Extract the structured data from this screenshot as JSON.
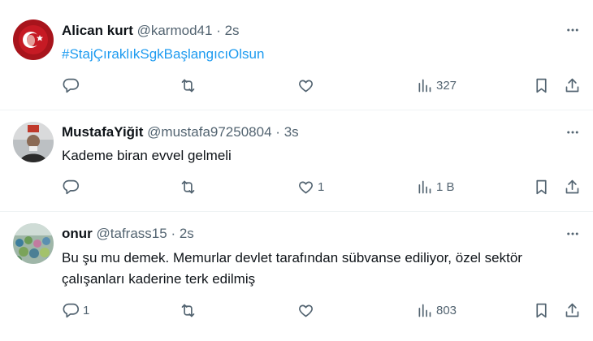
{
  "tweets": [
    {
      "name": "Alican kurt",
      "handle": "@karmod41",
      "separator": "·",
      "time": "2s",
      "text": "#StajÇıraklıkSgkBaşlangıcıOlsun",
      "text_is_hashtag": true,
      "replies": "",
      "retweets": "",
      "likes": "",
      "views": "327",
      "avatar": "turkish-flag-avatar"
    },
    {
      "name": "MustafaYiğit",
      "handle": "@mustafa97250804",
      "separator": "·",
      "time": "3s",
      "text": "Kademe biran evvel gelmeli",
      "replies": "",
      "retweets": "",
      "likes": "1",
      "views": "1 B",
      "avatar": "person-photo-avatar"
    },
    {
      "name": "onur",
      "handle": "@tafrass15",
      "separator": "·",
      "time": "2s",
      "text_line1": "Bu şu mu demek. Memurlar devlet tarafından sübvanse ediliyor, özel sektör",
      "text_line2": "çalışanları kaderine terk edilmiş",
      "replies": "1",
      "retweets": "",
      "likes": "",
      "views": "803",
      "avatar": "crowd-photo-avatar"
    }
  ],
  "colors": {
    "accent": "#1d9bf0",
    "secondary": "#536471",
    "text": "#0f1419"
  },
  "icons": [
    "reply-icon",
    "retweet-icon",
    "like-icon",
    "views-icon",
    "bookmark-icon",
    "share-icon",
    "more-icon"
  ]
}
